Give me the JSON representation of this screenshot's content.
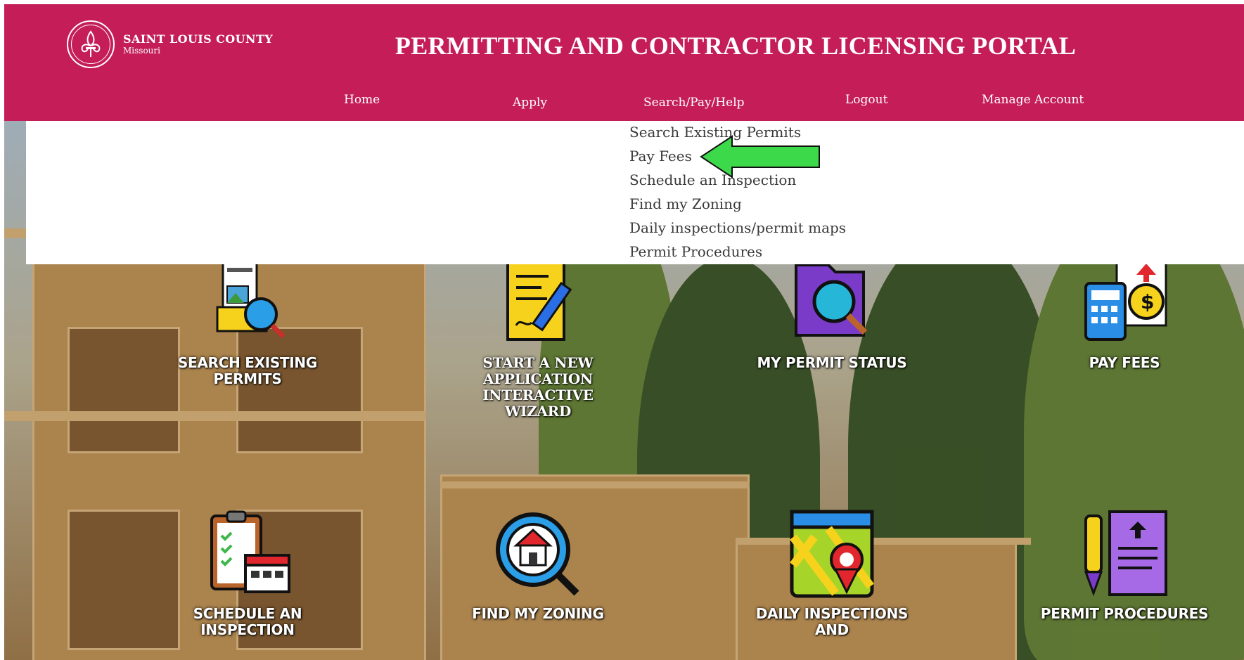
{
  "header": {
    "org_name": "SAINT LOUIS COUNTY",
    "org_sub": "Missouri",
    "portal_title": "PERMITTING AND CONTRACTOR LICENSING PORTAL"
  },
  "nav": {
    "items": [
      {
        "label": "Home"
      },
      {
        "label": "Apply"
      },
      {
        "label": "Search/Pay/Help"
      },
      {
        "label": "Logout"
      },
      {
        "label": "Manage Account"
      }
    ]
  },
  "dropdown": {
    "items": [
      {
        "label": "Search Existing Permits"
      },
      {
        "label": "Pay Fees"
      },
      {
        "label": "Schedule an Inspection"
      },
      {
        "label": "Find my Zoning"
      },
      {
        "label": "Daily inspections/permit maps"
      },
      {
        "label": "Permit Procedures"
      }
    ]
  },
  "tiles": [
    {
      "label": "SEARCH EXISTING PERMITS",
      "icon": "document-search-icon"
    },
    {
      "label": "START A NEW APPLICATION INTERACTIVE WIZARD",
      "icon": "pen-paper-icon"
    },
    {
      "label": "MY PERMIT STATUS",
      "icon": "folder-magnifier-icon"
    },
    {
      "label": "PAY FEES",
      "icon": "calculator-dollar-icon"
    },
    {
      "label": "SCHEDULE AN INSPECTION",
      "icon": "clipboard-calendar-icon"
    },
    {
      "label": "FIND MY ZONING",
      "icon": "house-magnifier-icon"
    },
    {
      "label": "DAILY INSPECTIONS AND",
      "icon": "map-pin-icon"
    },
    {
      "label": "PERMIT PROCEDURES",
      "icon": "pen-document-icon"
    }
  ],
  "colors": {
    "brand": "#c41d58",
    "arrow": "#3cd94a",
    "dropdown_text": "#3a3a3a"
  }
}
